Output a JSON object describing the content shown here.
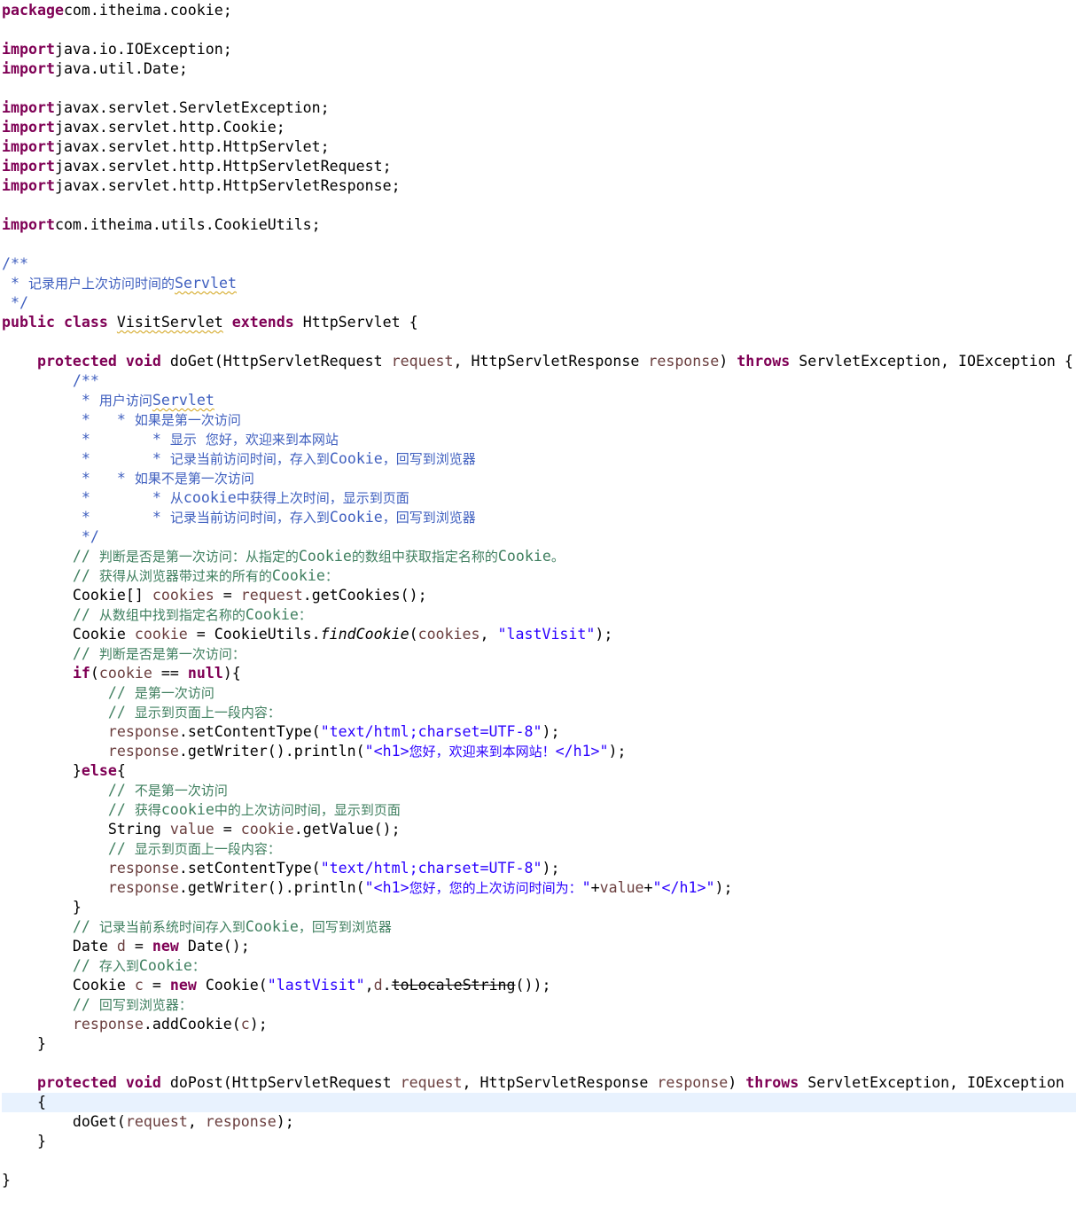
{
  "editor": {
    "language": "java",
    "current_line_index": 56,
    "colors": {
      "keyword": "#7f0055",
      "javadoc": "#3f5fbf",
      "line_comment": "#3f7f5f",
      "string": "#2a00ff",
      "local_variable": "#6a3e3e",
      "current_line": "#e8f2fe"
    },
    "lines": [
      [
        [
          "kw",
          "package"
        ],
        [
          "",
          "com.itheima.cookie;"
        ]
      ],
      [],
      [
        [
          "kw",
          "import"
        ],
        [
          "",
          "java.io.IOException;"
        ]
      ],
      [
        [
          "kw",
          "import"
        ],
        [
          "",
          "java.util.Date;"
        ]
      ],
      [],
      [
        [
          "kw",
          "import"
        ],
        [
          "",
          "javax.servlet.ServletException;"
        ]
      ],
      [
        [
          "kw",
          "import"
        ],
        [
          "",
          "javax.servlet.http.Cookie;"
        ]
      ],
      [
        [
          "kw",
          "import"
        ],
        [
          "",
          "javax.servlet.http.HttpServlet;"
        ]
      ],
      [
        [
          "kw",
          "import"
        ],
        [
          "",
          "javax.servlet.http.HttpServletRequest;"
        ]
      ],
      [
        [
          "kw",
          "import"
        ],
        [
          "",
          "javax.servlet.http.HttpServletResponse;"
        ]
      ],
      [],
      [
        [
          "kw",
          "import"
        ],
        [
          "",
          "com.itheima.utils.CookieUtils;"
        ]
      ],
      [],
      [
        [
          "cm",
          "/**"
        ]
      ],
      [
        [
          "cm",
          " * 记录用户上次访问时间的"
        ],
        [
          "cm sq",
          "Servlet"
        ]
      ],
      [
        [
          "cm",
          " */"
        ]
      ],
      [
        [
          "kw",
          "public"
        ],
        [
          "",
          " "
        ],
        [
          "kw",
          "class"
        ],
        [
          "",
          " "
        ],
        [
          "sq",
          "VisitServlet"
        ],
        [
          "",
          " "
        ],
        [
          "kw",
          "extends"
        ],
        [
          "",
          " HttpServlet {"
        ]
      ],
      [],
      [
        [
          "",
          "    "
        ],
        [
          "kw",
          "protected"
        ],
        [
          "",
          " "
        ],
        [
          "kw",
          "void"
        ],
        [
          "",
          " doGet(HttpServletRequest "
        ],
        [
          "var",
          "request"
        ],
        [
          "",
          ", HttpServletResponse "
        ],
        [
          "var",
          "response"
        ],
        [
          "",
          ") "
        ],
        [
          "kw",
          "throws"
        ],
        [
          "",
          " ServletException, IOException {"
        ]
      ],
      [
        [
          "cm",
          "        /**"
        ]
      ],
      [
        [
          "cm",
          "         * 用户访问"
        ],
        [
          "cm sq",
          "Servlet"
        ]
      ],
      [
        [
          "cm",
          "         *   * 如果是第一次访问"
        ]
      ],
      [
        [
          "cm",
          "         *       * 显示 您好，欢迎来到本网站"
        ]
      ],
      [
        [
          "cm",
          "         *       * 记录当前访问时间，存入到Cookie，回写到浏览器"
        ]
      ],
      [
        [
          "cm",
          "         *   * 如果不是第一次访问"
        ]
      ],
      [
        [
          "cm",
          "         *       * 从cookie中获得上次时间，显示到页面"
        ]
      ],
      [
        [
          "cm",
          "         *       * 记录当前访问时间，存入到Cookie，回写到浏览器"
        ]
      ],
      [
        [
          "cm",
          "         */"
        ]
      ],
      [
        [
          "lc",
          "        // 判断是否是第一次访问：从指定的Cookie的数组中获取指定名称的Cookie。"
        ]
      ],
      [
        [
          "lc",
          "        // 获得从浏览器带过来的所有的Cookie："
        ]
      ],
      [
        [
          "",
          "        Cookie[] "
        ],
        [
          "var",
          "cookies"
        ],
        [
          "",
          " = "
        ],
        [
          "var",
          "request"
        ],
        [
          "",
          ".getCookies();"
        ]
      ],
      [
        [
          "lc",
          "        // 从数组中找到指定名称的Cookie："
        ]
      ],
      [
        [
          "",
          "        Cookie "
        ],
        [
          "var",
          "cookie"
        ],
        [
          "",
          " = CookieUtils."
        ],
        [
          "it",
          "findCookie"
        ],
        [
          "",
          "("
        ],
        [
          "var",
          "cookies"
        ],
        [
          "",
          ", "
        ],
        [
          "str",
          "\"lastVisit\""
        ],
        [
          "",
          ");"
        ]
      ],
      [
        [
          "lc",
          "        // 判断是否是第一次访问："
        ]
      ],
      [
        [
          "",
          "        "
        ],
        [
          "kw",
          "if"
        ],
        [
          "",
          "("
        ],
        [
          "var",
          "cookie"
        ],
        [
          "",
          " == "
        ],
        [
          "kw",
          "null"
        ],
        [
          "",
          "){"
        ]
      ],
      [
        [
          "lc",
          "            // 是第一次访问"
        ]
      ],
      [
        [
          "lc",
          "            // 显示到页面上一段内容："
        ]
      ],
      [
        [
          "",
          "            "
        ],
        [
          "var",
          "response"
        ],
        [
          "",
          ".setContentType("
        ],
        [
          "str",
          "\"text/html;charset=UTF-8\""
        ],
        [
          "",
          ");"
        ]
      ],
      [
        [
          "",
          "            "
        ],
        [
          "var",
          "response"
        ],
        [
          "",
          ".getWriter().println("
        ],
        [
          "str",
          "\"<h1>您好，欢迎来到本网站！</h1>\""
        ],
        [
          "",
          ");"
        ]
      ],
      [
        [
          "",
          "        }"
        ],
        [
          "kw",
          "else"
        ],
        [
          "",
          "{"
        ]
      ],
      [
        [
          "lc",
          "            // 不是第一次访问"
        ]
      ],
      [
        [
          "lc",
          "            // 获得cookie中的上次访问时间，显示到页面"
        ]
      ],
      [
        [
          "",
          "            String "
        ],
        [
          "var",
          "value"
        ],
        [
          "",
          " = "
        ],
        [
          "var",
          "cookie"
        ],
        [
          "",
          ".getValue();"
        ]
      ],
      [
        [
          "lc",
          "            // 显示到页面上一段内容："
        ]
      ],
      [
        [
          "",
          "            "
        ],
        [
          "var",
          "response"
        ],
        [
          "",
          ".setContentType("
        ],
        [
          "str",
          "\"text/html;charset=UTF-8\""
        ],
        [
          "",
          ");"
        ]
      ],
      [
        [
          "",
          "            "
        ],
        [
          "var",
          "response"
        ],
        [
          "",
          ".getWriter().println("
        ],
        [
          "str",
          "\"<h1>您好，您的上次访问时间为：\""
        ],
        [
          "",
          "+"
        ],
        [
          "var",
          "value"
        ],
        [
          "",
          "+"
        ],
        [
          "str",
          "\"</h1>\""
        ],
        [
          "",
          ");"
        ]
      ],
      [
        [
          "",
          "        }"
        ]
      ],
      [
        [
          "lc",
          "        // 记录当前系统时间存入到Cookie，回写到浏览器"
        ]
      ],
      [
        [
          "",
          "        Date "
        ],
        [
          "var",
          "d"
        ],
        [
          "",
          " = "
        ],
        [
          "kw",
          "new"
        ],
        [
          "",
          " Date();"
        ]
      ],
      [
        [
          "lc",
          "        // 存入到Cookie："
        ]
      ],
      [
        [
          "",
          "        Cookie "
        ],
        [
          "var",
          "c"
        ],
        [
          "",
          " = "
        ],
        [
          "kw",
          "new"
        ],
        [
          "",
          " Cookie("
        ],
        [
          "str",
          "\"lastVisit\""
        ],
        [
          "",
          ","
        ],
        [
          "var",
          "d"
        ],
        [
          "",
          "."
        ],
        [
          "depr sq",
          "toLocaleString"
        ],
        [
          "",
          "());"
        ]
      ],
      [
        [
          "lc",
          "        // 回写到浏览器："
        ]
      ],
      [
        [
          "",
          "        "
        ],
        [
          "var",
          "response"
        ],
        [
          "",
          ".addCookie("
        ],
        [
          "var",
          "c"
        ],
        [
          "",
          ");"
        ]
      ],
      [
        [
          "",
          "    }"
        ]
      ],
      [],
      [
        [
          "",
          "    "
        ],
        [
          "kw",
          "protected"
        ],
        [
          "",
          " "
        ],
        [
          "kw",
          "void"
        ],
        [
          "",
          " doPost(HttpServletRequest "
        ],
        [
          "var",
          "request"
        ],
        [
          "",
          ", HttpServletResponse "
        ],
        [
          "var",
          "response"
        ],
        [
          "",
          ") "
        ],
        [
          "kw",
          "throws"
        ],
        [
          "",
          " ServletException, IOException"
        ]
      ],
      [
        [
          "",
          "    {"
        ]
      ],
      [
        [
          "",
          "        doGet("
        ],
        [
          "var",
          "request"
        ],
        [
          "",
          ", "
        ],
        [
          "var",
          "response"
        ],
        [
          "",
          ");"
        ]
      ],
      [
        [
          "",
          "    }"
        ]
      ],
      [],
      [
        [
          "",
          "}"
        ]
      ]
    ]
  }
}
